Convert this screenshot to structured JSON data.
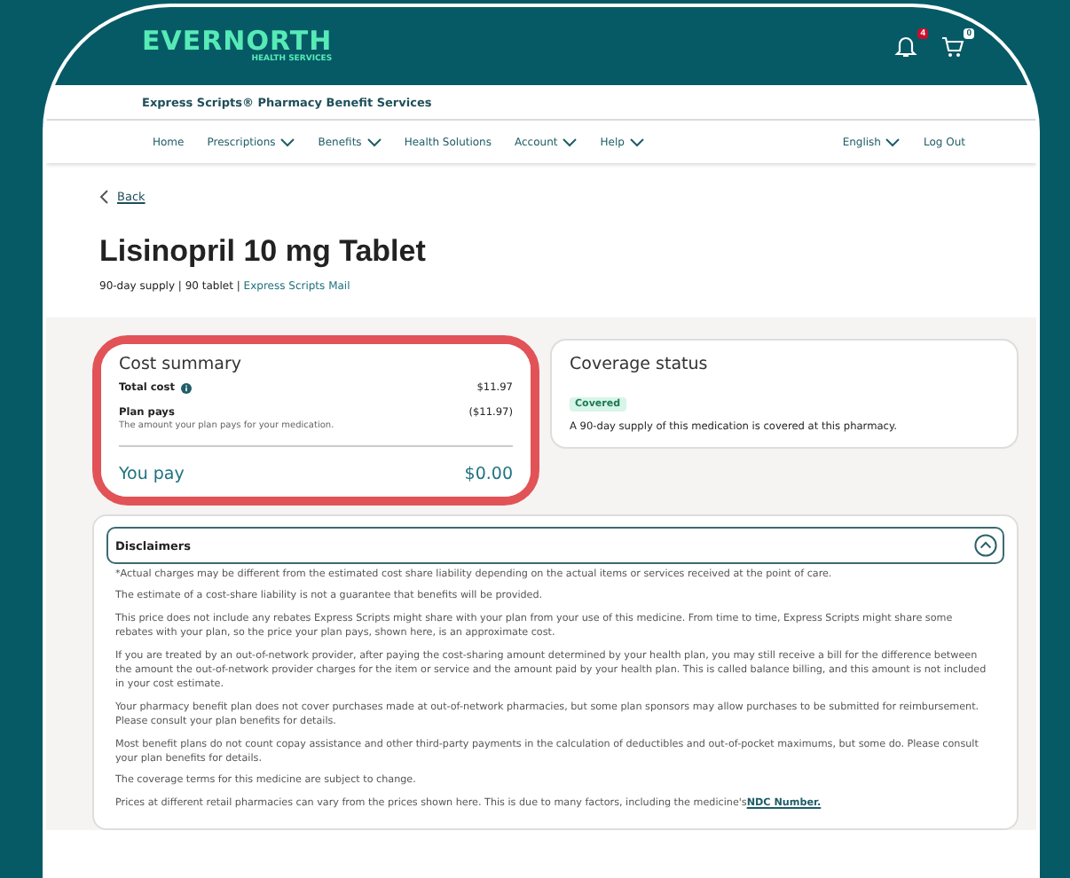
{
  "header": {
    "logo": "EVERNORTH",
    "logo_sub": "HEALTH SERVICES",
    "notification_count": "4",
    "cart_count": "0"
  },
  "brand_bar": {
    "title": "Express Scripts® Pharmacy Benefit Services"
  },
  "nav": {
    "items": [
      {
        "label": "Home",
        "dropdown": false
      },
      {
        "label": "Prescriptions",
        "dropdown": true
      },
      {
        "label": "Benefits",
        "dropdown": true
      },
      {
        "label": "Health Solutions",
        "dropdown": false
      },
      {
        "label": "Account",
        "dropdown": true
      },
      {
        "label": "Help",
        "dropdown": true
      }
    ],
    "right": [
      {
        "label": "English",
        "dropdown": true
      },
      {
        "label": "Log Out",
        "dropdown": false
      }
    ]
  },
  "back": "Back",
  "title": "Lisinopril 10 mg Tablet",
  "meta": "90-day supply | 90 tablet |",
  "meta_link": "Express Scripts Mail",
  "cost_summary": {
    "title": "Cost summary",
    "highlighted": true,
    "rows": [
      {
        "label": "Total cost",
        "info": true,
        "amount": "$11.97"
      },
      {
        "label": "Plan pays",
        "info": false,
        "amount": "($11.97)",
        "note": "The amount your plan pays for your medication."
      }
    ],
    "total": {
      "label": "You pay",
      "amount": "$0.00"
    }
  },
  "coverage": {
    "title": "Coverage status",
    "badge": "Covered",
    "text": "A 90-day supply of this medication is covered at this pharmacy."
  },
  "disclaimers": {
    "title": "Disclaimers",
    "expanded": true,
    "paragraphs": [
      {
        "text": "*Actual charges may be different from the estimated cost share liability depending on the actual items or services received at the point of care."
      },
      {
        "text": "The estimate of a cost-share liability is not a guarantee that benefits will be provided."
      },
      {
        "text": "This price does not include any rebates Express Scripts might share with your plan from your use of this medicine. From time to time, Express Scripts might share some rebates with your plan, so the price your plan pays, shown here, is an approximate cost."
      },
      {
        "text": "If you are treated by an out-of-network provider, after paying the cost-sharing amount determined by your health plan, you may still receive a bill for the difference between the amount the out-of-network provider charges for the item or service and the amount paid by your health plan. This is called balance billing, and this amount is not included in your cost estimate."
      },
      {
        "text": "Your pharmacy benefit plan does not cover purchases made at out-of-network pharmacies, but some plan sponsors may allow purchases to be submitted for reimbursement. Please consult your plan benefits for details."
      },
      {
        "text": "Most benefit plans do not count copay assistance and other third-party payments in the calculation of deductibles and out-of-pocket maximums, but some do. Please consult your plan benefits for details."
      },
      {
        "text": "The coverage terms for this medicine are subject to change."
      },
      {
        "text": "Prices at different retail pharmacies can vary from the prices shown here. This is due to many factors, including the medicine's",
        "link": "NDC Number."
      }
    ]
  }
}
